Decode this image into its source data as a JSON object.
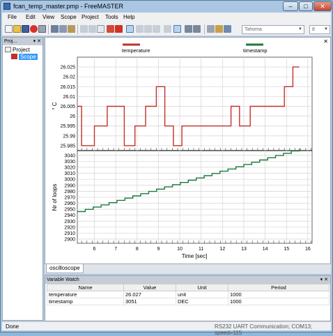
{
  "window": {
    "title": "fcan_temp_master.pmp - FreeMASTER"
  },
  "titlebar_buttons": {
    "minimize": "–",
    "maximize": "□",
    "close": "✕"
  },
  "menu": [
    "File",
    "Edit",
    "View",
    "Scope",
    "Project",
    "Tools",
    "Help"
  ],
  "toolbar": {
    "icons": [
      "new-icon",
      "open-icon",
      "save-icon",
      "stop-icon",
      "print-icon",
      "cut-icon",
      "copy-icon",
      "paste-icon",
      "undo-icon",
      "redo-icon",
      "page-icon",
      "scope-icon",
      "graph-icon",
      "cursor-icon",
      "zoom-icon",
      "zoom-out-icon",
      "zoom-fit-icon",
      "grid-icon",
      "up-icon",
      "down-icon",
      "properties-icon",
      "help-icon"
    ],
    "font_value": "Tahoma",
    "size_value": "8"
  },
  "project_pane": {
    "header": "Proj...",
    "pin": "▾ ✕",
    "tree": {
      "root": "Project",
      "child": "Scope"
    }
  },
  "scope": {
    "close": "✕",
    "legend": [
      {
        "name": "temperature",
        "color": "#c0302c"
      },
      {
        "name": "timestamp",
        "color": "#1a7a3a"
      }
    ]
  },
  "chart_data": [
    {
      "type": "line",
      "ylabel": "° C",
      "y_ticks": [
        "26.025",
        "26.02",
        "26.015",
        "26.01",
        "26.005",
        "26",
        "25.995",
        "25.99",
        "25.985"
      ],
      "ylim": [
        25.9825,
        26.03
      ],
      "xlim": [
        5.2,
        16.2
      ],
      "grid": true,
      "series": [
        {
          "name": "temperature",
          "color": "#c0302c",
          "x": [
            5.2,
            5.4,
            5.4,
            6.0,
            6.0,
            6.6,
            6.6,
            7.4,
            7.4,
            7.9,
            7.9,
            8.4,
            8.4,
            8.9,
            8.9,
            9.3,
            9.3,
            9.7,
            9.7,
            10.1,
            10.1,
            10.5,
            10.5,
            12.4,
            12.4,
            12.8,
            12.8,
            13.3,
            13.3,
            14.9,
            14.9,
            15.3,
            15.3,
            15.6
          ],
          "y": [
            26.005,
            26.005,
            25.985,
            25.985,
            25.995,
            25.995,
            26.005,
            26.005,
            25.985,
            25.985,
            25.995,
            25.995,
            26.005,
            26.005,
            26.015,
            26.015,
            25.995,
            25.995,
            25.985,
            25.985,
            25.995,
            25.995,
            25.995,
            25.995,
            26.005,
            26.005,
            25.995,
            25.995,
            26.005,
            26.005,
            26.015,
            26.015,
            26.025,
            26.025
          ]
        }
      ]
    },
    {
      "type": "line",
      "ylabel": "Nr of loops",
      "xlabel": "Time [sec]",
      "x_ticks": [
        "6",
        "7",
        "8",
        "9",
        "10",
        "11",
        "12",
        "13",
        "14",
        "15",
        "16"
      ],
      "y_ticks": [
        "3040",
        "3030",
        "3020",
        "3010",
        "3000",
        "2990",
        "2980",
        "2970",
        "2960",
        "2950",
        "2940",
        "2930",
        "2920",
        "2910",
        "2900"
      ],
      "ylim": [
        2893,
        3048
      ],
      "xlim": [
        5.2,
        16.2
      ],
      "grid": true,
      "series": [
        {
          "name": "timestamp",
          "color": "#1a7a3a",
          "x": [
            5.2,
            15.6
          ],
          "y": [
            2946,
            3051
          ]
        }
      ]
    }
  ],
  "tab": {
    "label": "oscilloscope"
  },
  "variable_watch": {
    "header": "Variable Watch",
    "pin": "▾ ✕",
    "columns": [
      "Name",
      "Value",
      "Unit",
      "Period"
    ],
    "rows": [
      [
        "temperature",
        "26.027",
        "unit",
        "1000"
      ],
      [
        "timestamp",
        "3051",
        "DEC",
        "1000"
      ]
    ]
  },
  "status": {
    "left": "Done",
    "right": "RS232 UART Communication; COM13; speed=115"
  }
}
